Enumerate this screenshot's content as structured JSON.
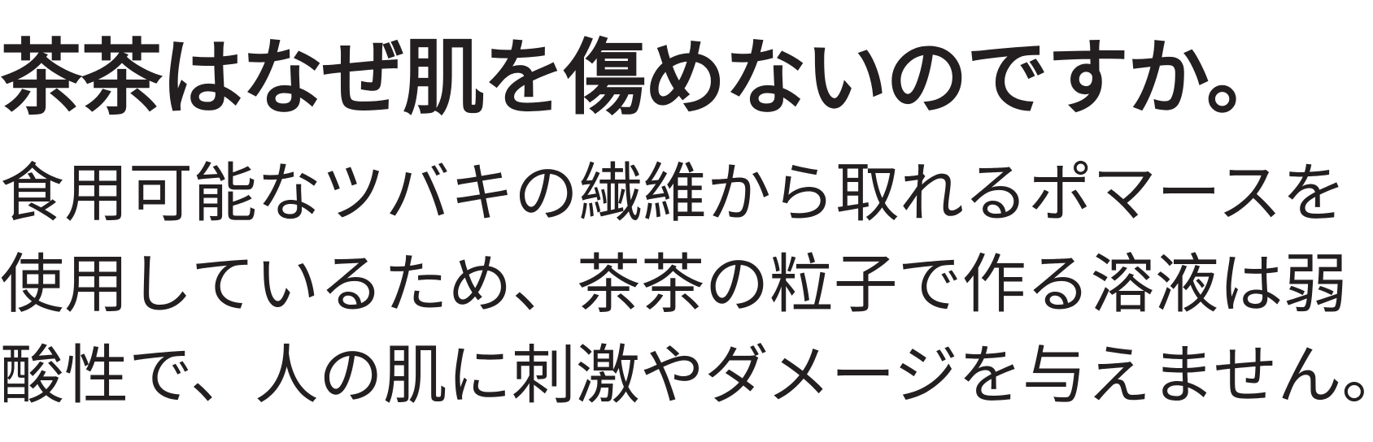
{
  "heading": "茶茶はなぜ肌を傷めないのですか。",
  "paragraph_lines": [
    "食用可能なツバキの繊維から取れるポマースを",
    "使用しているため、茶茶の粒子で作る溶液は弱",
    "酸性で、人の肌に刺激やダメージを与えません。"
  ],
  "text_color": "#231f20"
}
